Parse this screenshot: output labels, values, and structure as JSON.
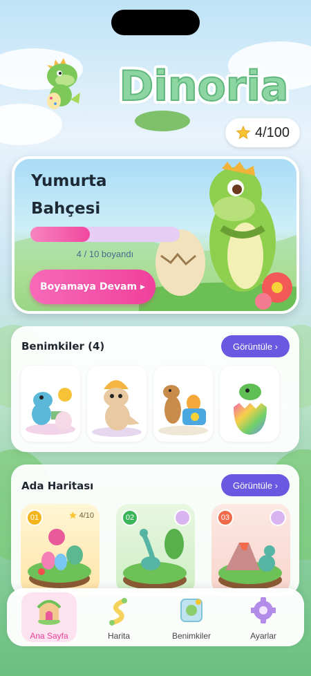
{
  "app": {
    "logo_text": "Dinoria"
  },
  "stars": {
    "label": "4/100"
  },
  "hero": {
    "title_line1": "Yumurta",
    "title_line2": "Bahçesi",
    "progress_fraction": 0.4,
    "progress_text": "4 / 10 boyandı",
    "continue_label": "Boyamaya Devam ▸"
  },
  "mine": {
    "title": "Benimkiler (4)",
    "view_label": "Görüntüle ›"
  },
  "map": {
    "title": "Ada Haritası",
    "view_label": "Görüntüle ›",
    "islands": [
      {
        "number": "01",
        "progress": "4/10",
        "color": "#f2b51c"
      },
      {
        "number": "02",
        "color": "#3bb55a"
      },
      {
        "number": "03",
        "color": "#ef6a4a"
      }
    ]
  },
  "nav": {
    "items": [
      {
        "label": "Ana Sayfa"
      },
      {
        "label": "Harita"
      },
      {
        "label": "Benimkiler"
      },
      {
        "label": "Ayarlar"
      }
    ]
  },
  "colors": {
    "accent_purple": "#6a58e0",
    "accent_pink": "#f0409b",
    "active_nav_label": "#e8409a"
  }
}
